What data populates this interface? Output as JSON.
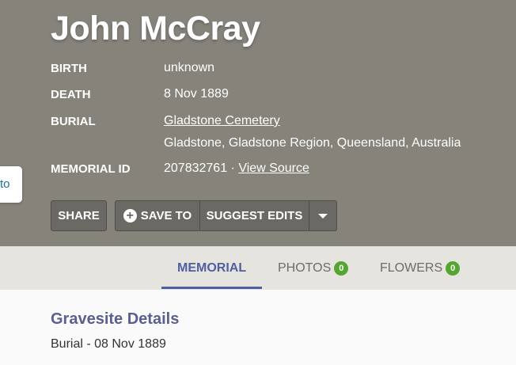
{
  "memorial": {
    "name": "John McCray",
    "side_link_text": "to",
    "facts": {
      "birth_label": "Birth",
      "birth_value": "unknown",
      "death_label": "Death",
      "death_value": "8 Nov 1889",
      "burial_label": "Burial",
      "burial_cemetery": "Gladstone Cemetery",
      "burial_location": "Gladstone, Gladstone Region, Queensland, Australia",
      "memorial_id_label": "Memorial ID",
      "memorial_id_value": "207832761 ·",
      "view_source": "View Source"
    }
  },
  "actions": {
    "share": "Share",
    "save_to": "Save To",
    "suggest_edits": "Suggest Edits",
    "more_icon": "caret-down-icon"
  },
  "tabs": [
    {
      "label": "Memorial",
      "active": true
    },
    {
      "label": "Photos",
      "count": "0"
    },
    {
      "label": "Flowers",
      "count": "0"
    }
  ],
  "gravesite": {
    "title": "Gravesite Details",
    "text": "Burial - 08 Nov 1889"
  },
  "colors": {
    "hero_bg": "#86837b",
    "accent": "#4f5fa0",
    "badge": "#54a630",
    "tab_bar": "#e6e4df"
  }
}
